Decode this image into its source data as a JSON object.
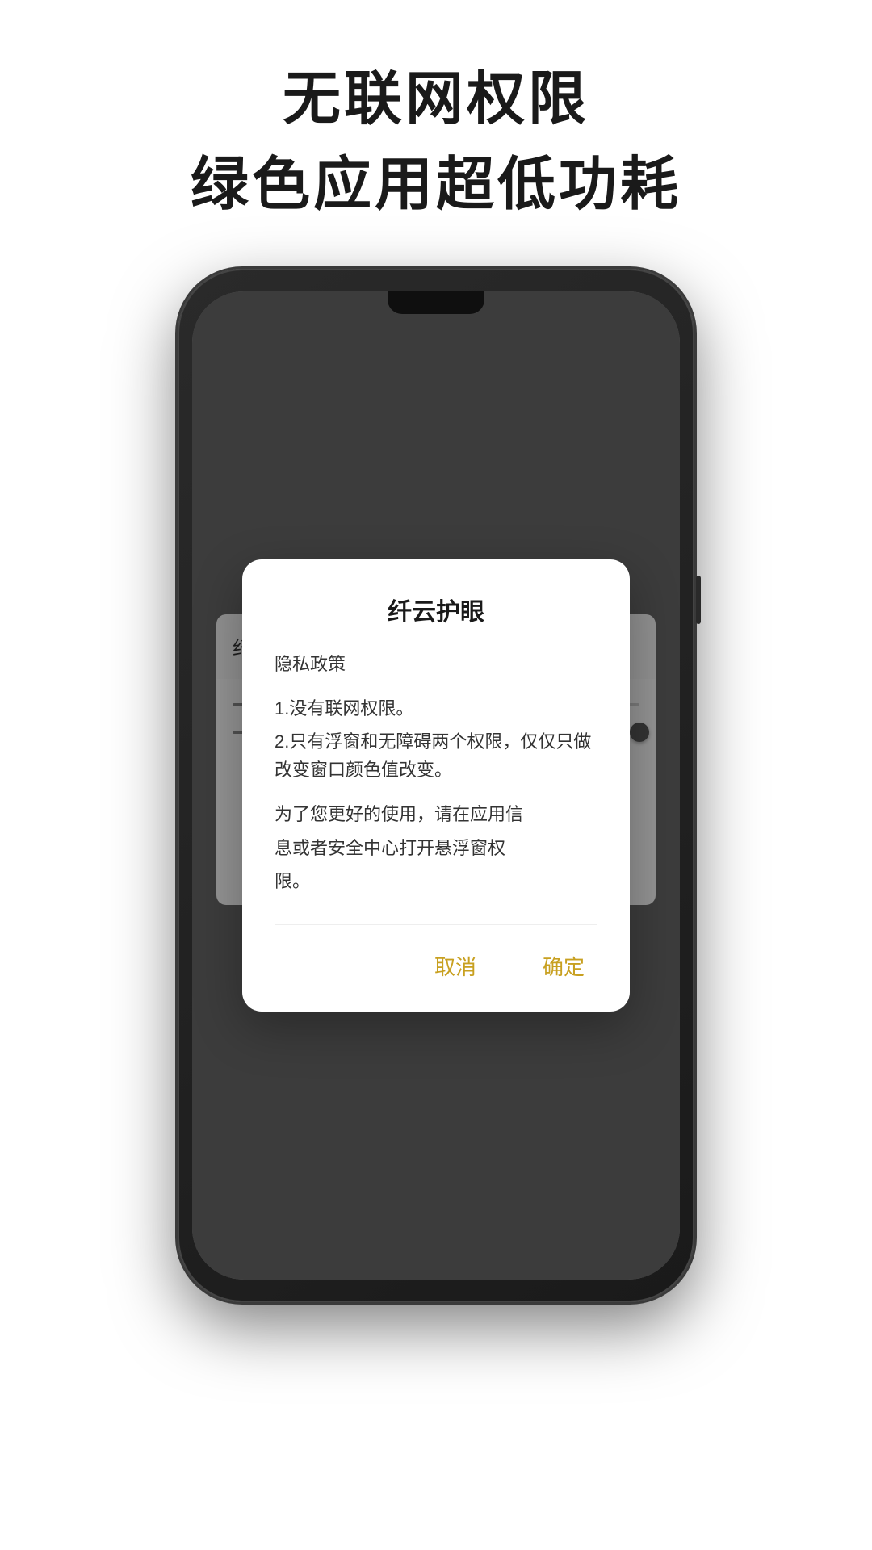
{
  "headline": {
    "line1": "无联网权限",
    "line2": "绿色应用超低功耗"
  },
  "phone": {
    "app_bar": {
      "title": "纤云...",
      "menu_icon": "⋮"
    }
  },
  "dialog": {
    "title": "纤云护眼",
    "body_line1": "隐私政策",
    "body_line2": "1.没有联网权限。",
    "body_line3": "2.只有浮窗和无障碍两个权限，",
    "body_line4": "仅仅只做改变窗口颜色值改变。",
    "body_line5": "为了您更好的使用，请在应用信",
    "body_line6": "息或者安全中心打开悬浮窗权",
    "body_line7": "限。",
    "cancel_label": "取消",
    "confirm_label": "确定",
    "button_color": "#c8a020"
  }
}
